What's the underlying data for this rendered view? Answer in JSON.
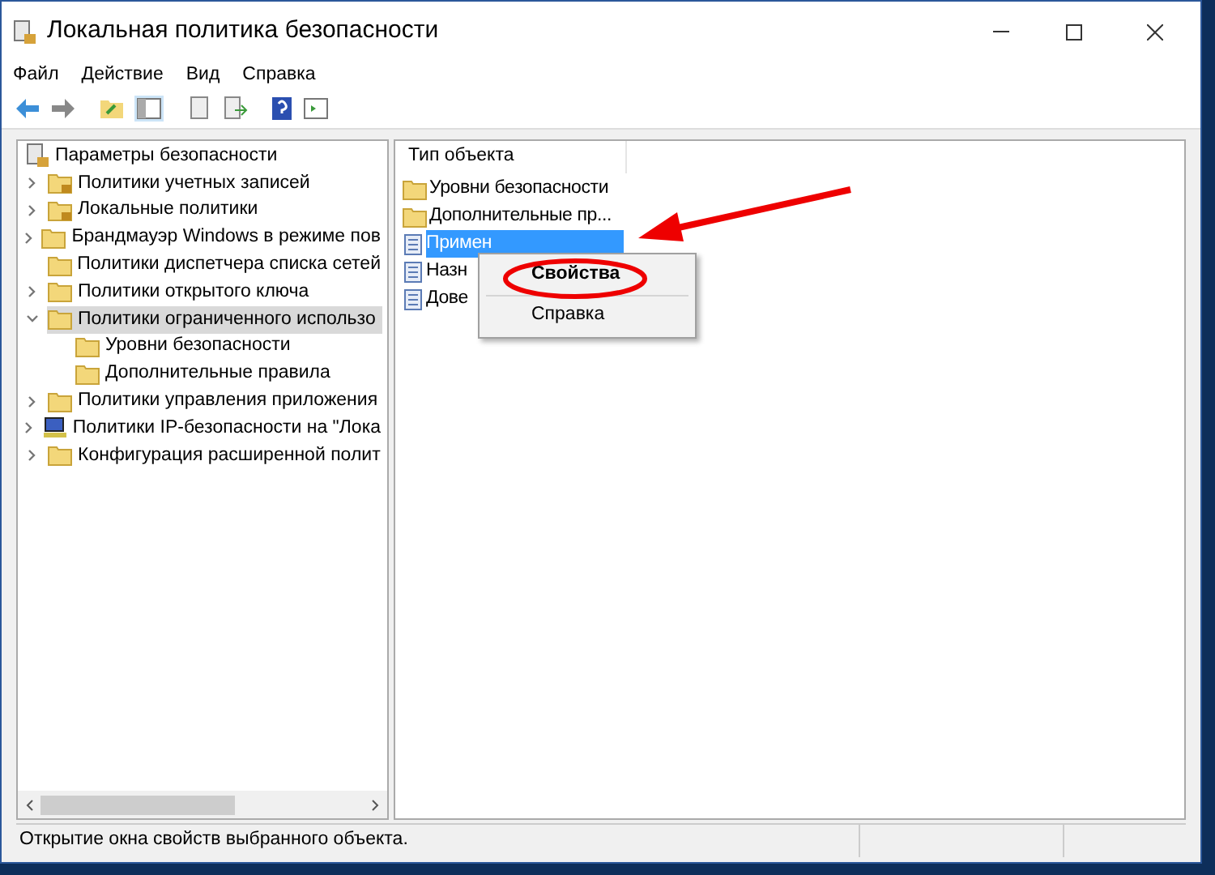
{
  "window": {
    "title": "Локальная политика безопасности"
  },
  "menu": [
    "Файл",
    "Действие",
    "Вид",
    "Справка"
  ],
  "tree": {
    "label": "Параметры безопасности",
    "kind": "policy",
    "children": [
      {
        "label": "Политики учетных записей",
        "kind": "locked-folder",
        "expanded": false,
        "selected": false
      },
      {
        "label": "Локальные политики",
        "kind": "locked-folder",
        "expanded": false,
        "selected": false
      },
      {
        "label": "Брандмауэр Windows в режиме пов",
        "kind": "folder",
        "expanded": false,
        "selected": false
      },
      {
        "label": "Политики диспетчера списка сетей",
        "kind": "folder",
        "selected": false
      },
      {
        "label": "Политики открытого ключа",
        "kind": "folder",
        "expanded": false,
        "selected": false
      },
      {
        "label": "Политики ограниченного использо",
        "kind": "folder",
        "expanded": true,
        "selected": true,
        "children": [
          {
            "label": "Уровни безопасности",
            "kind": "folder",
            "selected": false
          },
          {
            "label": "Дополнительные правила",
            "kind": "folder",
            "selected": false
          }
        ]
      },
      {
        "label": "Политики управления приложения",
        "kind": "folder",
        "expanded": false,
        "selected": false
      },
      {
        "label": "Политики IP-безопасности на \"Лока",
        "kind": "network",
        "expanded": false,
        "selected": false
      },
      {
        "label": "Конфигурация расширенной полит",
        "kind": "folder",
        "expanded": false,
        "selected": false
      }
    ]
  },
  "list": {
    "column": "Тип объекта",
    "items": [
      {
        "label": "Уровни безопасности",
        "kind": "folder",
        "selected": false
      },
      {
        "label": "Дополнительные пр...",
        "kind": "folder",
        "selected": false
      },
      {
        "label": "Примен",
        "kind": "file",
        "selected": true
      },
      {
        "label": "Назн",
        "kind": "file",
        "selected": false
      },
      {
        "label": "Дове",
        "kind": "file",
        "selected": false
      }
    ]
  },
  "context_menu": [
    {
      "label": "Свойства",
      "bold": true
    },
    {
      "label": "Справка",
      "bold": false
    }
  ],
  "status_bar": "Открытие окна свойств выбранного объекта."
}
